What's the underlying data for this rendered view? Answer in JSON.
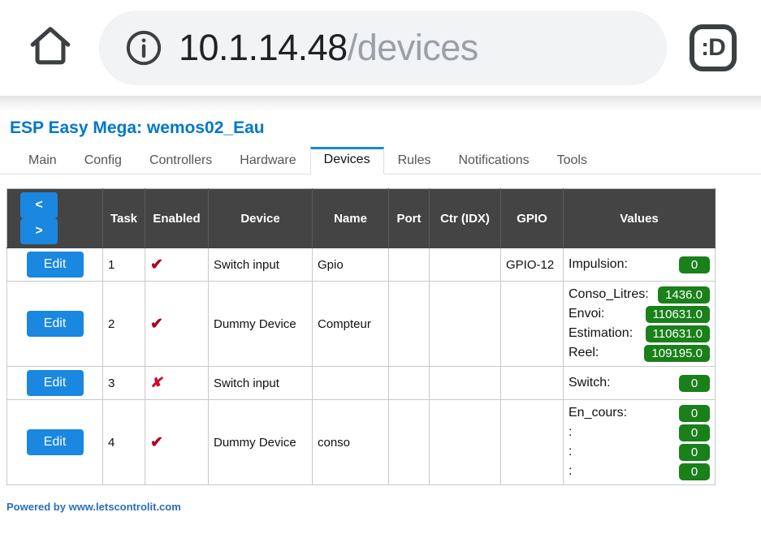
{
  "browser": {
    "home_icon": "home-icon",
    "info_icon": "site-info-icon",
    "url_host": "10.1.14.48",
    "url_path": "/devices",
    "profile_label": ":D"
  },
  "page": {
    "title": "ESP Easy Mega: wemos02_Eau",
    "footer": "Powered by www.letscontrolit.com"
  },
  "tabs": [
    {
      "label": "Main",
      "active": false
    },
    {
      "label": "Config",
      "active": false
    },
    {
      "label": "Controllers",
      "active": false
    },
    {
      "label": "Hardware",
      "active": false
    },
    {
      "label": "Devices",
      "active": true
    },
    {
      "label": "Rules",
      "active": false
    },
    {
      "label": "Notifications",
      "active": false
    },
    {
      "label": "Tools",
      "active": false
    }
  ],
  "table": {
    "nav": {
      "prev_label": "<",
      "next_label": ">"
    },
    "headers": {
      "task": "Task",
      "enabled": "Enabled",
      "device": "Device",
      "name": "Name",
      "port": "Port",
      "ctr": "Ctr (IDX)",
      "gpio": "GPIO",
      "values": "Values"
    },
    "edit_label": "Edit",
    "enabled_on_glyph": "✔",
    "enabled_off_glyph": "✘",
    "rows": [
      {
        "task": "1",
        "enabled": true,
        "device": "Switch input",
        "name": "Gpio",
        "port": "",
        "ctr": "",
        "gpio": "GPIO-12",
        "values": [
          {
            "label": "Impulsion:",
            "value": "0"
          }
        ]
      },
      {
        "task": "2",
        "enabled": true,
        "device": "Dummy Device",
        "name": "Compteur",
        "port": "",
        "ctr": "",
        "gpio": "",
        "values": [
          {
            "label": "Conso_Litres:",
            "value": "1436.0"
          },
          {
            "label": "Envoi:",
            "value": "110631.0"
          },
          {
            "label": "Estimation:",
            "value": "110631.0"
          },
          {
            "label": "Reel:",
            "value": "109195.0"
          }
        ]
      },
      {
        "task": "3",
        "enabled": false,
        "device": "Switch input",
        "name": "",
        "port": "",
        "ctr": "",
        "gpio": "",
        "values": [
          {
            "label": "Switch:",
            "value": "0"
          }
        ]
      },
      {
        "task": "4",
        "enabled": true,
        "device": "Dummy Device",
        "name": "conso",
        "port": "",
        "ctr": "",
        "gpio": "",
        "values": [
          {
            "label": "En_cours:",
            "value": "0"
          },
          {
            "label": ":",
            "value": "0"
          },
          {
            "label": ":",
            "value": "0"
          },
          {
            "label": ":",
            "value": "0"
          }
        ]
      }
    ]
  },
  "colors": {
    "accent_blue": "#1a87e0",
    "title_blue": "#0077cc",
    "header_gray": "#444444",
    "badge_green": "#1a801a",
    "mark_red": "#b00020",
    "url_pill": "#f1f3f4"
  }
}
